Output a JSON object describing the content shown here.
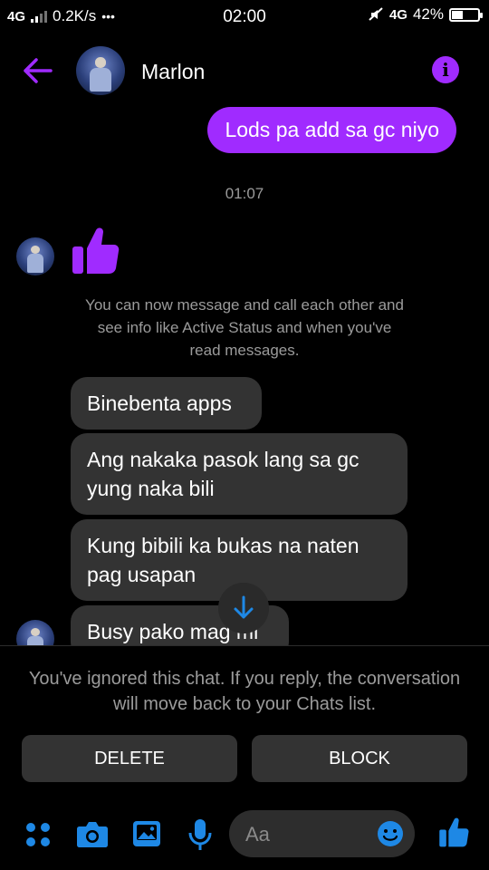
{
  "status_bar": {
    "network_left": "4G",
    "speed": "0.2K/s",
    "dots": "•••",
    "time": "02:00",
    "network_right": "4G",
    "battery_text": "42%",
    "battery_level": 0.42
  },
  "header": {
    "contact_name": "Marlon",
    "info_glyph": "i"
  },
  "messages": {
    "outgoing": "Lods pa add sa gc niyo",
    "timestamp": "01:07",
    "notice": "You can now message and call each other and see info like Active Status and when you've read messages.",
    "incoming": [
      "Binebenta apps",
      "Ang nakaka pasok lang sa gc yung naka bili",
      "Kung bibili ka bukas na naten pag usapan",
      "Busy pako mag ml"
    ]
  },
  "bottom": {
    "ignored_notice": "You've ignored this chat. If you reply, the conversation will move back to your Chats list.",
    "delete_label": "DELETE",
    "block_label": "BLOCK",
    "input_placeholder": "Aa"
  },
  "colors": {
    "accent": "#a02bff",
    "composer_icon": "#1e88e5",
    "bubble_in": "#333333",
    "muted_text": "#9b9b9b"
  },
  "icons": [
    "back-arrow-icon",
    "info-icon",
    "thumbs-up-icon",
    "arrow-down-icon",
    "menu-dots-icon",
    "camera-icon",
    "image-icon",
    "microphone-icon",
    "emoji-icon",
    "mute-icon"
  ]
}
